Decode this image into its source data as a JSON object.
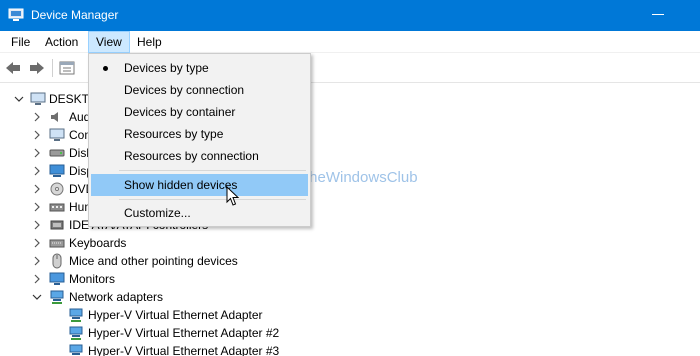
{
  "window": {
    "title": "Device Manager"
  },
  "menubar": {
    "items": [
      "File",
      "Action",
      "View",
      "Help"
    ]
  },
  "tree": {
    "root": "DESKTOP",
    "categories": [
      "Audio",
      "Com",
      "Disk",
      "Disp",
      "DVD",
      "Hum",
      "IDE ATA/ATAPI controllers",
      "Keyboards",
      "Mice and other pointing devices",
      "Monitors",
      "Network adapters"
    ],
    "network_children": [
      "Hyper-V Virtual Ethernet Adapter",
      "Hyper-V Virtual Ethernet Adapter #2",
      "Hyper-V Virtual Ethernet Adapter #3"
    ]
  },
  "view_menu": {
    "items": [
      "Devices by type",
      "Devices by connection",
      "Devices by container",
      "Resources by type",
      "Resources by connection",
      "Show hidden devices",
      "Customize..."
    ],
    "selected": "Devices by type",
    "highlighted": "Show hidden devices"
  },
  "watermark": {
    "text": "TheWindowsClub"
  },
  "colors": {
    "titlebar": "#0078d7",
    "menu_active": "#cce8ff",
    "dropdown_hover": "#91c9f7",
    "dropdown_bg": "#f2f2f2",
    "watermark": "#9fc3e8"
  }
}
